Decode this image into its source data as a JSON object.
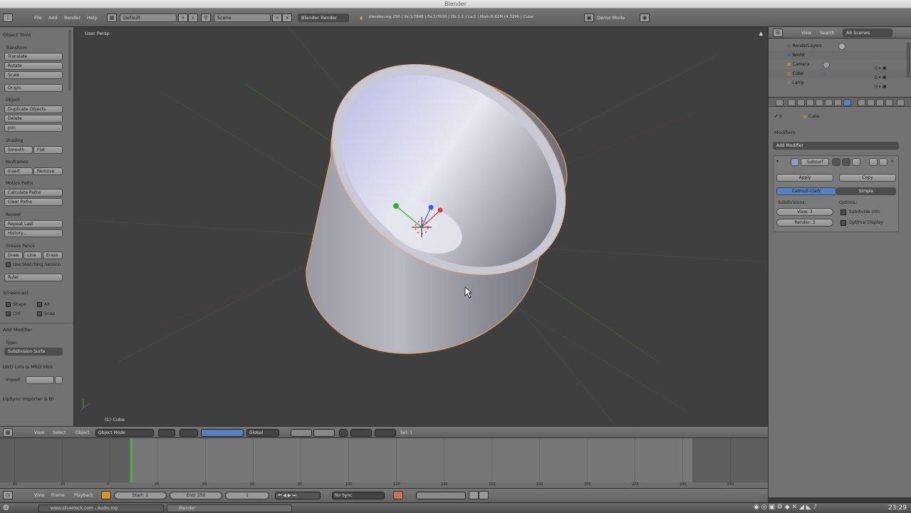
{
  "window": {
    "title": "Blender"
  },
  "infobar": {
    "menus": [
      "File",
      "Add",
      "Render",
      "Help"
    ],
    "layout": "Default",
    "scene": "Scene",
    "engine": "Blender Render",
    "stats": "blender.org 258 | Ve:1/7848 | Fa:1/7616 | Ob:1-1 | La:1 | Mem:6.62M (4.32M) | Cube",
    "demo_mode": "Demo Mode"
  },
  "toolshelf": {
    "title": "Object Tools",
    "transform": {
      "label": "Transform",
      "buttons": [
        "Translate",
        "Rotate",
        "Scale",
        "Origin"
      ]
    },
    "object": {
      "label": "Object",
      "buttons": [
        "Duplicate Objects",
        "Delete",
        "Join"
      ]
    },
    "shading": {
      "label": "Shading",
      "smooth": "Smooth",
      "flat": "Flat"
    },
    "keyframes": {
      "label": "Keyframes",
      "insert": "Insert",
      "remove": "Remove"
    },
    "motion_paths": {
      "label": "Motion Paths",
      "buttons": [
        "Calculate Paths",
        "Clear Paths"
      ]
    },
    "repeat": {
      "label": "Repeat",
      "buttons": [
        "Repeat Last",
        "History..."
      ]
    },
    "grease_pencil": {
      "label": "Grease Pencil",
      "draw": "Draw",
      "line": "Line",
      "erase": "Erase",
      "sketch": "Use Sketching Session",
      "ruler": "Ruler"
    },
    "screencast": {
      "label": "Screencast",
      "shape": "Shape",
      "alt": "Alt",
      "ctrl": "Ctrl",
      "snap": "Snap"
    },
    "add_modifier": {
      "label": "Add Modifier",
      "type_label": "Type:",
      "type_value": "Subdivision Surfa"
    },
    "import_panel": {
      "label": "LWO Lots & MRD Mini",
      "import_label": "Import"
    },
    "last_panel": "LipSync Importer & Bl"
  },
  "viewport": {
    "view_label": "User Persp",
    "object_label": "(1) Cube"
  },
  "outliner": {
    "header": {
      "view": "View",
      "search": "Search",
      "filter": "All Scenes"
    },
    "items": [
      "RenderLayers",
      "World",
      "Camera",
      "Cube",
      "Lamp"
    ]
  },
  "properties": {
    "breadcrumb": "Cube",
    "panel_title": "Modifiers",
    "add_modifier": "Add Modifier",
    "modifier_name": "Subsurf",
    "apply": "Apply",
    "copy": "Copy",
    "algorithm_active": "Catmull-Clark",
    "algorithm_other": "Simple",
    "subdivisions_label": "Subdivisions:",
    "view_field": "View: 3",
    "render_field": "Render: 3",
    "options_label": "Options:",
    "subdivide_uvs": "Subdivide UVs",
    "optimal_display": "Optimal Display"
  },
  "viewport_header": {
    "view": "View",
    "select": "Select",
    "object": "Object",
    "mode": "Object Mode",
    "orientation": "Global",
    "layer_label": "Sel: 1"
  },
  "timeline": {
    "ticks": [
      "-40",
      "-20",
      "0",
      "20",
      "40",
      "60",
      "80",
      "100",
      "120",
      "140",
      "160",
      "180",
      "200",
      "220",
      "240",
      "260"
    ],
    "current_frame": "1"
  },
  "footer": {
    "view": "View",
    "frame": "Frame",
    "playback": "Playback",
    "start": "Start: 1",
    "end": "End: 250",
    "current": "1",
    "sync": "No Sync"
  },
  "taskbar": {
    "browser": "www.silverrock.com - Audio.mp",
    "app": "Blender",
    "time": "23:29"
  },
  "colors": {
    "accent": "#5680c2",
    "cursor_green": "#33c633",
    "panel": "#727272",
    "viewport": "#3f3f3f"
  }
}
